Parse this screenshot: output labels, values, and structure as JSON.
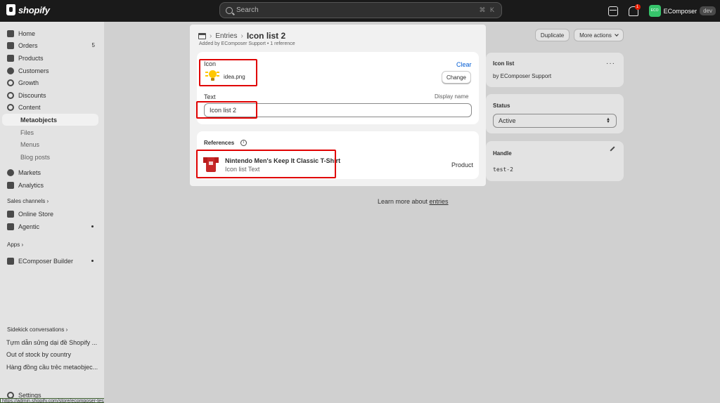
{
  "topbar": {
    "brand": "shopify",
    "search_placeholder": "Search",
    "search_shortcut": "⌘ K",
    "notification_count": "1",
    "store_avatar": "ECO",
    "store_name": "EComposer",
    "store_badge": "dev"
  },
  "sidebar": {
    "items": [
      {
        "label": "Home",
        "icon": "home-icon"
      },
      {
        "label": "Orders",
        "icon": "orders-icon",
        "count": "5"
      },
      {
        "label": "Products",
        "icon": "products-icon"
      },
      {
        "label": "Customers",
        "icon": "customers-icon"
      },
      {
        "label": "Growth",
        "icon": "growth-icon"
      },
      {
        "label": "Discounts",
        "icon": "discounts-icon"
      },
      {
        "label": "Content",
        "icon": "content-icon"
      },
      {
        "label": "Metaobjects"
      },
      {
        "label": "Files"
      },
      {
        "label": "Menus"
      },
      {
        "label": "Blog posts"
      },
      {
        "label": "Markets",
        "icon": "markets-icon"
      },
      {
        "label": "Analytics",
        "icon": "analytics-icon"
      }
    ],
    "sales_channels_label": "Sales channels",
    "channels": [
      {
        "label": "Online Store",
        "icon": "online-store-icon"
      },
      {
        "label": "Agentic",
        "icon": "agentic-icon"
      }
    ],
    "apps_label": "Apps",
    "apps": [
      {
        "label": "EComposer Builder",
        "icon": "app-icon"
      }
    ],
    "sidekick_label": "Sidekick conversations",
    "conversations": [
      "Tựm dẫn sửng dại đề Shopify ...",
      "Out of stock by country",
      "Hàng đồng cầu trẻc metaobjec..."
    ],
    "settings_label": "Settings",
    "status_url": "https://admin.shopify.com/store/ecomposer-testing/orders"
  },
  "entry": {
    "breadcrumb_parent": "Entries",
    "title": "Icon list 2",
    "added_by": "Added by EComposer Support • 1 reference",
    "icon_label": "Icon",
    "clear_label": "Clear",
    "file_name": "idea.png",
    "change_label": "Change",
    "text_label": "Text",
    "display_name_label": "Display name",
    "text_value": "Icon list 2",
    "references_label": "References",
    "reference": {
      "name": "Nintendo Men's Keep It Classic T-Shirt",
      "sub": "Icon list Text",
      "type": "Product"
    },
    "learn_prefix": "Learn more about ",
    "learn_link": "entries"
  },
  "actions": {
    "duplicate": "Duplicate",
    "more_actions": "More actions"
  },
  "info_card": {
    "title": "Icon list",
    "subtitle": "by EComposer Support"
  },
  "status_card": {
    "title": "Status",
    "value": "Active"
  },
  "handle_card": {
    "title": "Handle",
    "value": "test-2"
  },
  "colors": {
    "highlight": "#e00000",
    "link": "#005bd3",
    "topbar": "#1a1a1a"
  }
}
